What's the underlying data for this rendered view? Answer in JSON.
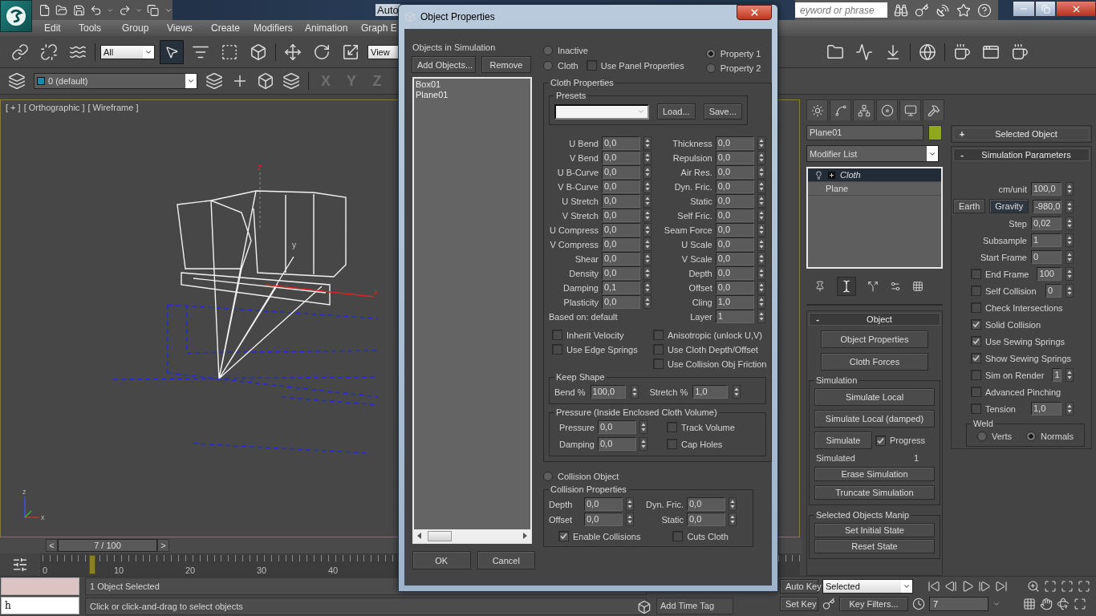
{
  "app": {
    "title": "Auto",
    "search_placeholder": "eyword or phrase"
  },
  "menu": [
    "Edit",
    "Tools",
    "Group",
    "Views",
    "Create",
    "Modifiers",
    "Animation",
    "Graph E"
  ],
  "toolbar": {
    "selection_filter": "All",
    "select_tool_active": true,
    "coord_system": "View",
    "layer": "0 (default)",
    "axes": [
      "X",
      "Y",
      "Z"
    ]
  },
  "viewport": {
    "labels": [
      "[ + ]",
      "[ Orthographic ]",
      "[ Wireframe ]"
    ],
    "axis_labels": [
      "z",
      "y",
      "x"
    ],
    "gizmo_labels": [
      "z",
      "x"
    ]
  },
  "time_slider": {
    "prev": "<",
    "reading": "7 / 100",
    "next": ">"
  },
  "track_bar": {
    "ticks": [
      "0",
      "10",
      "20",
      "30",
      "40"
    ],
    "level": 0.07
  },
  "status": {
    "script_output": "h",
    "selection": "1 Object Selected",
    "prompt": "Click or click-and-drag to select objects",
    "time_tag": "Add Time Tag"
  },
  "animation_controls": {
    "auto_key": "Auto Key",
    "key_mode": "Selected",
    "set_key": "Set Key",
    "key_filters": "Key Filters...",
    "frame": "7"
  },
  "command_panel": {
    "object_name": "Plane01",
    "modifier_list": "Modifier List",
    "stack": [
      {
        "name": "Cloth",
        "selected": true,
        "kind": "modifier"
      },
      {
        "name": "Plane",
        "selected": false,
        "kind": "base"
      }
    ],
    "object_rollout": {
      "toggle": "-",
      "title": "Object",
      "expanded": true,
      "buttons": [
        "Object Properties",
        "Cloth Forces"
      ],
      "simulation": {
        "title": "Simulation",
        "buttons": [
          "Simulate Local",
          "Simulate Local (damped)"
        ],
        "simulate": "Simulate",
        "progress": {
          "label": "Progress",
          "checked": true
        },
        "simulated_label": "Simulated",
        "simulated_value": "1",
        "more_buttons": [
          "Erase Simulation",
          "Truncate Simulation"
        ]
      },
      "manip": {
        "title": "Selected Objects Manip",
        "buttons": [
          "Set Initial State",
          "Reset State"
        ]
      }
    },
    "selected_object_rollout": {
      "toggle": "+",
      "title": "Selected Object",
      "expanded": false
    },
    "simulation_parameters": {
      "toggle": "-",
      "title": "Simulation Parameters",
      "expanded": true,
      "rows": [
        {
          "kind": "field",
          "label": "cm/unit",
          "value": "100,0"
        },
        {
          "kind": "gravity",
          "buttons": [
            {
              "label": "Earth",
              "pressed": false
            },
            {
              "label": "Gravity",
              "pressed": true
            }
          ],
          "value": "-980,0"
        },
        {
          "kind": "field",
          "label": "Step",
          "value": "0,02"
        },
        {
          "kind": "field",
          "label": "Subsample",
          "value": "1"
        },
        {
          "kind": "field",
          "label": "Start Frame",
          "value": "0"
        },
        {
          "kind": "check_field",
          "label": "End Frame",
          "checked": false,
          "value": "100"
        },
        {
          "kind": "check_field",
          "label": "Self Collision",
          "checked": false,
          "value": "0"
        },
        {
          "kind": "check",
          "label": "Check Intersections",
          "checked": false
        },
        {
          "kind": "check",
          "label": "Solid Collision",
          "checked": true
        },
        {
          "kind": "check",
          "label": "Use Sewing Springs",
          "checked": true
        },
        {
          "kind": "check",
          "label": "Show Sewing Springs",
          "checked": true
        },
        {
          "kind": "check_field",
          "label": "Sim on Render",
          "checked": false,
          "value": "1"
        },
        {
          "kind": "check",
          "label": "Advanced Pinching",
          "checked": false
        },
        {
          "kind": "check_field",
          "label": "Tension",
          "checked": false,
          "value": "1,0"
        }
      ],
      "weld": {
        "title": "Weld",
        "options": [
          {
            "label": "Verts",
            "selected": false
          },
          {
            "label": "Normals",
            "selected": true
          }
        ]
      }
    }
  },
  "dialog": {
    "title": "Object Properties",
    "objects_label": "Objects in Simulation",
    "list_buttons": [
      "Add Objects...",
      "Remove"
    ],
    "objects": [
      "Box01",
      "Plane01"
    ],
    "footer_buttons": [
      "OK",
      "Cancel"
    ],
    "mode_options": [
      {
        "label": "Inactive",
        "selected": false
      },
      {
        "label": "Cloth",
        "selected": false
      }
    ],
    "use_panel_properties": {
      "label": "Use Panel Properties",
      "checked": false
    },
    "property_options": [
      {
        "label": "Property 1",
        "selected": true
      },
      {
        "label": "Property 2",
        "selected": false
      }
    ],
    "cloth_properties": {
      "title": "Cloth Properties",
      "presets_title": "Presets",
      "preset_buttons": [
        "Load...",
        "Save..."
      ],
      "left": [
        {
          "label": "U Bend",
          "value": "0,0"
        },
        {
          "label": "V Bend",
          "value": "0,0"
        },
        {
          "label": "U B-Curve",
          "value": "0,0"
        },
        {
          "label": "V B-Curve",
          "value": "0,0"
        },
        {
          "label": "U Stretch",
          "value": "0,0"
        },
        {
          "label": "V Stretch",
          "value": "0,0"
        },
        {
          "label": "U Compress",
          "value": "0,0"
        },
        {
          "label": "V Compress",
          "value": "0,0"
        },
        {
          "label": "Shear",
          "value": "0,0"
        },
        {
          "label": "Density",
          "value": "0,0"
        },
        {
          "label": "Damping",
          "value": "0,1"
        },
        {
          "label": "Plasticity",
          "value": "0,0"
        }
      ],
      "right": [
        {
          "label": "Thickness",
          "value": "0,0"
        },
        {
          "label": "Repulsion",
          "value": "0,0"
        },
        {
          "label": "Air Res.",
          "value": "0,0"
        },
        {
          "label": "Dyn. Fric.",
          "value": "0,0"
        },
        {
          "label": "Static",
          "value": "0,0"
        },
        {
          "label": "Self Fric.",
          "value": "0,0"
        },
        {
          "label": "Seam Force",
          "value": "0,0"
        },
        {
          "label": "U Scale",
          "value": "0,0"
        },
        {
          "label": "V Scale",
          "value": "0,0"
        },
        {
          "label": "Depth",
          "value": "0,0"
        },
        {
          "label": "Offset",
          "value": "0,0"
        },
        {
          "label": "Cling",
          "value": "1,0"
        }
      ],
      "based_on": "Based on: default",
      "layer": {
        "label": "Layer",
        "value": "1"
      },
      "options_left": [
        {
          "label": "Inherit Velocity",
          "checked": false
        },
        {
          "label": "Use Edge Springs",
          "checked": false
        }
      ],
      "options_right": [
        {
          "label": "Anisotropic (unlock U,V)",
          "checked": false
        },
        {
          "label": "Use Cloth Depth/Offset",
          "checked": false
        },
        {
          "label": "Use Collision Obj Friction",
          "checked": false
        }
      ],
      "keep_shape": {
        "title": "Keep Shape",
        "fields": [
          {
            "label": "Bend %",
            "value": "100,0"
          },
          {
            "label": "Stretch %",
            "value": "1,0"
          }
        ]
      },
      "pressure": {
        "title": "Pressure (Inside Enclosed Cloth Volume)",
        "fields": [
          {
            "label": "Pressure",
            "value": "0,0"
          },
          {
            "label": "Damping",
            "value": "0,0"
          }
        ],
        "options": [
          {
            "label": "Track Volume",
            "checked": false
          },
          {
            "label": "Cap Holes",
            "checked": false
          }
        ]
      }
    },
    "collision_object": {
      "label": "Collision Object",
      "selected": false
    },
    "collision_properties": {
      "title": "Collision Properties",
      "fields_left": [
        {
          "label": "Depth",
          "value": "0,0"
        },
        {
          "label": "Offset",
          "value": "0,0"
        }
      ],
      "fields_right": [
        {
          "label": "Dyn. Fric.",
          "value": "0,0"
        },
        {
          "label": "Static",
          "value": "0,0"
        }
      ],
      "options": [
        {
          "label": "Enable Collisions",
          "checked": true
        },
        {
          "label": "Cuts Cloth",
          "checked": false
        }
      ]
    }
  }
}
